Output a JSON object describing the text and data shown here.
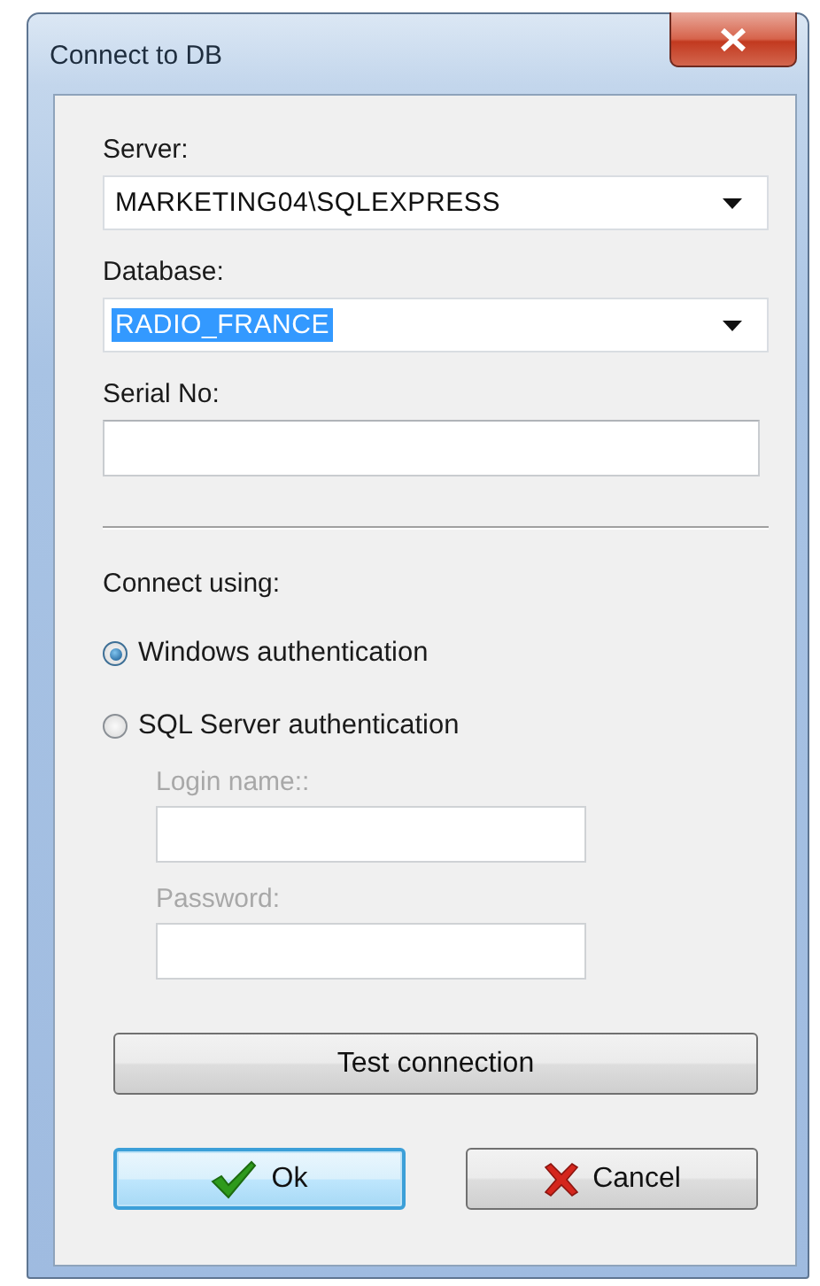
{
  "window": {
    "title": "Connect to DB"
  },
  "server": {
    "label": "Server:",
    "value": "MARKETING04\\SQLEXPRESS"
  },
  "database": {
    "label": "Database:",
    "value": "RADIO_FRANCE",
    "text_selected": true
  },
  "serial": {
    "label": "Serial No:"
  },
  "connect_using": {
    "label": "Connect using:",
    "options": [
      {
        "label": "Windows authentication",
        "selected": true
      },
      {
        "label": "SQL Server authentication",
        "selected": false
      }
    ]
  },
  "login": {
    "label": "Login name::",
    "disabled": true
  },
  "password": {
    "label": "Password:",
    "disabled": true
  },
  "buttons": [
    {
      "label": "Test connection",
      "kind": "wide",
      "default": false
    },
    {
      "label": "Ok",
      "kind": "ok",
      "default": true
    },
    {
      "label": "Cancel",
      "kind": "cancel",
      "default": false
    }
  ]
}
